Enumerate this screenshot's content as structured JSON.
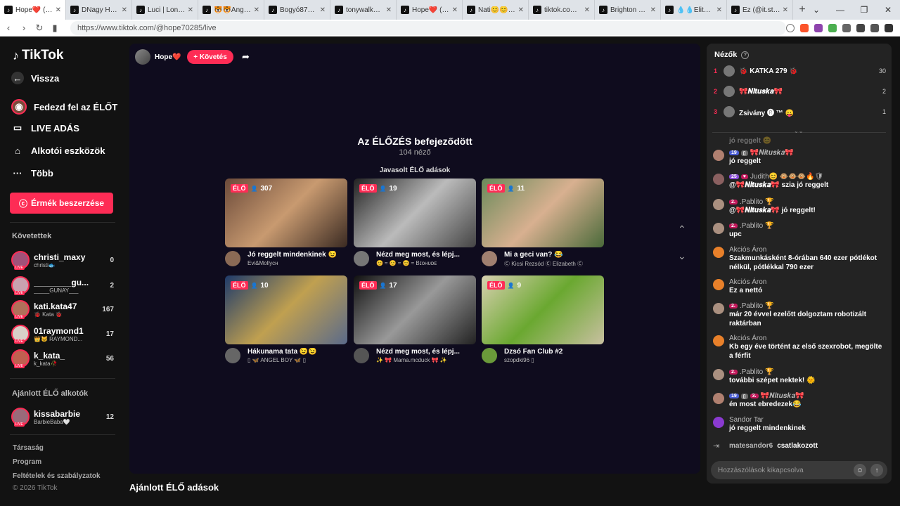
{
  "browser": {
    "tabs": [
      {
        "title": "Hope❤️ (@h",
        "active": true
      },
      {
        "title": "DNagy HajnalD"
      },
      {
        "title": "Luci | London Liv"
      },
      {
        "title": "🐯🐯Angika072"
      },
      {
        "title": "Bogyó87🥒🥒"
      },
      {
        "title": "tonywalks83 (@t"
      },
      {
        "title": "Hope❤️ (@hope"
      },
      {
        "title": "Nati😊😊🥰"
      },
      {
        "title": "tiktok.com/@fel"
      },
      {
        "title": "Brighton City as"
      },
      {
        "title": "💧💧Elite Jáno"
      },
      {
        "title": "Ez (@it.stinx) ÉL"
      }
    ],
    "new_tab": "+",
    "window_controls": [
      "⌄",
      "—",
      "❐",
      "✕"
    ],
    "url": "https://www.tiktok.com/@hope70285/live"
  },
  "sidebar": {
    "logo": "TikTok",
    "nav": [
      {
        "label": "Vissza",
        "icon": "back-arrow-icon",
        "glyph": "←"
      },
      {
        "label": "Fedezd fel az ÉLŐT",
        "icon": "explore-live-icon",
        "glyph": "◉"
      },
      {
        "label": "LIVE ADÁS",
        "icon": "video-camera-icon",
        "glyph": "▭"
      },
      {
        "label": "Alkotói eszközök",
        "icon": "creator-tools-icon",
        "glyph": "⌂"
      },
      {
        "label": "Több",
        "icon": "more-icon",
        "glyph": "···"
      }
    ],
    "coins_button": "Érmék beszerzése",
    "following_heading": "Követettek",
    "following": [
      {
        "name": "christi_maxy",
        "sub": "christi🐟",
        "count": "0",
        "color": "#a0527a"
      },
      {
        "name": "________gu...",
        "sub": "_____GUNAY___",
        "count": "2",
        "color": "#c9a2b0"
      },
      {
        "name": "kati.kata47",
        "sub": "🐞 Kata 🐞",
        "count": "167",
        "color": "#b0705a"
      },
      {
        "name": "01raymond1",
        "sub": "👑🐱 RAYMOND...",
        "count": "17",
        "color": "#d8d0c8"
      },
      {
        "name": "k_kata_",
        "sub": "k_kata🥀",
        "count": "56",
        "color": "#c06050"
      }
    ],
    "suggested_heading": "Ajánlott ÉLŐ alkotók",
    "suggested": [
      {
        "name": "kissabarbie",
        "sub": "BarbieBaba🤍",
        "count": "12",
        "color": "#9a6a7a"
      }
    ],
    "footer": [
      "Társaság",
      "Program",
      "Feltételek és szabályzatok",
      "© 2026 TikTok"
    ]
  },
  "stream": {
    "host_name": "Hope❤️",
    "follow_button": "+ Követés",
    "ended_title": "Az ÉLŐZÉS befejeződött",
    "viewers": "104 néző",
    "recommended_heading": "Javasolt ÉLŐ adások",
    "live_badge": "ÉLŐ",
    "cards": [
      {
        "count": "307",
        "title": "Jó reggelt mindenkinek 😉",
        "sub": "Evi&Mollyᴄʜ",
        "bg": "linear-gradient(135deg,#6b4a3a,#c89a70 50%,#3a2a22)",
        "av": "#8a6a55"
      },
      {
        "count": "19",
        "title": "Nézd meg most, és lépj...",
        "sub": "😊 ≈ 😊 ≈ 😊 ≈ Bɪᴏʜᴜᴅᴇ",
        "bg": "linear-gradient(135deg,#222,#bbb 50%,#444)",
        "av": "#777"
      },
      {
        "count": "11",
        "title": "Mi a geci van? 😂",
        "sub": "Ⓒ Kicsi Rezsód Ⓒ Elizabeth Ⓒ",
        "bg": "linear-gradient(135deg,#6a8a5a,#d8b090 50%,#4a6a3a)",
        "av": "#a08070"
      },
      {
        "count": "10",
        "title": "Hákunama tata 😉😉",
        "sub": "▯ 🦋 ANGEL BOY 🦋 ▯",
        "bg": "linear-gradient(135deg,#1e3a6a,#c0a050 50%,#5a6a8a)",
        "av": "#666"
      },
      {
        "count": "17",
        "title": "Nézd meg most, és lépj...",
        "sub": "✨ 🎀 Mama.mcduck 🎀 ✨",
        "bg": "linear-gradient(135deg,#111,#999 50%,#222)",
        "av": "#555"
      },
      {
        "count": "9",
        "title": "Dzsó Fan Club #2",
        "sub": "szopdki96 ▯",
        "bg": "linear-gradient(135deg,#d8d0b0,#6aa830 50%,#c8c0a0)",
        "av": "#6a9a3a"
      }
    ],
    "bottom_heading": "Ajánlott ÉLŐ adások"
  },
  "panel": {
    "heading": "Nézők",
    "viewers": [
      {
        "rank": "1",
        "name": "🐞 KATKA 279 🐞",
        "count": "30"
      },
      {
        "rank": "2",
        "name": "🎀𝑵𝒊𝒕𝒖𝒔𝒌𝒂🎀",
        "count": "2"
      },
      {
        "rank": "3",
        "name": "Zsivány 🅡 ™ 😛",
        "count": "1"
      }
    ],
    "messages": [
      {
        "name": "",
        "text": "jó reggelt 😊",
        "faded": true
      },
      {
        "name": "🎀𝑵𝒊𝒕𝒖𝒔𝒌𝒂🎀",
        "badges": [
          {
            "t": "19",
            "c": "blue"
          },
          {
            "t": "▯",
            "c": "grey"
          }
        ],
        "text": "jó reggelt",
        "av": "#b08070"
      },
      {
        "name": "Judith😊 🐵🐵🐵🔥🛡",
        "badges": [
          {
            "t": "25",
            "c": "purple"
          },
          {
            "t": "♥",
            "c": "red"
          }
        ],
        "text": "@🎀𝑵𝒊𝒕𝒖𝒔𝒌𝒂🎀 szia jó reggelt",
        "av": "#8a6060"
      },
      {
        "name": ".Pablito 🏆",
        "badges": [
          {
            "t": "2.",
            "c": "red"
          }
        ],
        "text": "@🎀𝑵𝒊𝒕𝒖𝒔𝒌𝒂🎀 jó reggelt!",
        "av": "#aa9080"
      },
      {
        "name": ".Pablito 🏆",
        "badges": [
          {
            "t": "2.",
            "c": "red"
          }
        ],
        "text": "upc",
        "av": "#aa9080"
      },
      {
        "name": "Akciós Áron",
        "badges": [],
        "text": "Szakmunkásként 8-órában 640 ezer pótlékot nélkül, pótlékkal 790 ezer",
        "av": "#e8802a"
      },
      {
        "name": "Akciós Áron",
        "badges": [],
        "text": "Ez a nettó",
        "av": "#e8802a"
      },
      {
        "name": ".Pablito 🏆",
        "badges": [
          {
            "t": "2.",
            "c": "red"
          }
        ],
        "text": "már 20 évvel ezelőtt dolgoztam robotizált raktárban",
        "av": "#aa9080"
      },
      {
        "name": "Akciós Áron",
        "badges": [],
        "text": "Kb egy éve történt az első szexrobot, megölte a férfit",
        "av": "#e8802a"
      },
      {
        "name": ".Pablito 🏆",
        "badges": [
          {
            "t": "2.",
            "c": "red"
          }
        ],
        "text": "további szépet nektek! 🌞",
        "av": "#aa9080"
      },
      {
        "name": "🎀𝑵𝒊𝒕𝒖𝒔𝒌𝒂🎀",
        "badges": [
          {
            "t": "19",
            "c": "blue"
          },
          {
            "t": "▯",
            "c": "grey"
          },
          {
            "t": "3.",
            "c": "red"
          }
        ],
        "text": "én most ebredezek😂",
        "av": "#b08070"
      },
      {
        "name": "Sandor Tar",
        "badges": [],
        "text": "jó reggelt mindenkinek",
        "av": "#8a3ad0"
      }
    ],
    "join_user": "matesandor6",
    "join_text": "csatlakozott",
    "chat_placeholder": "Hozzászólások kikapcsolva"
  }
}
